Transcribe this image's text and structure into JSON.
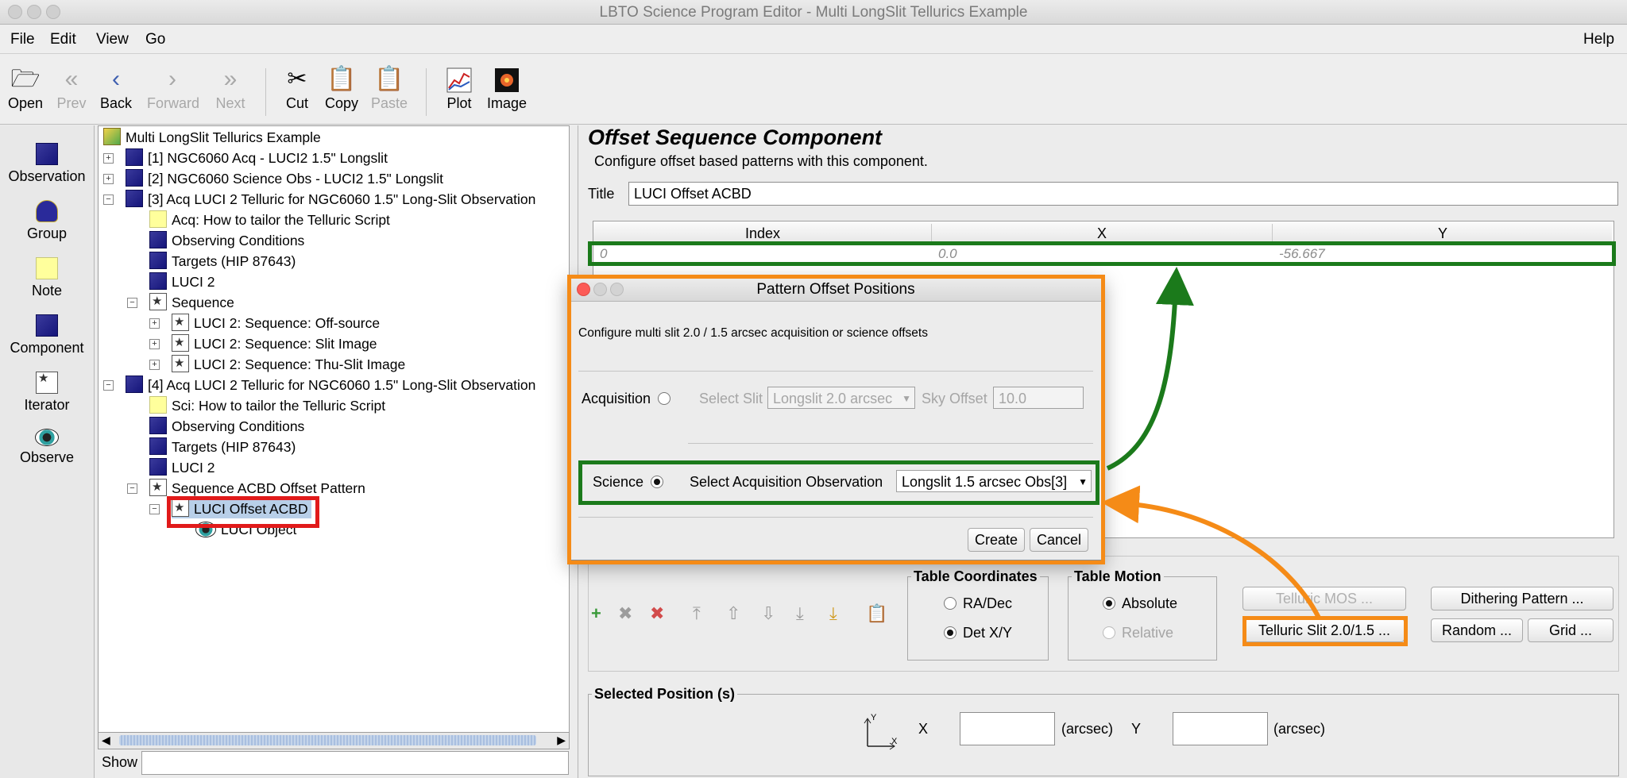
{
  "window": {
    "title": "LBTO Science Program Editor - Multi LongSlit Tellurics Example"
  },
  "menu": {
    "items": [
      "File",
      "Edit",
      "View",
      "Go"
    ],
    "help": "Help"
  },
  "toolbar": {
    "buttons": [
      {
        "label": "Open",
        "icon": "folder-icon"
      },
      {
        "label": "Prev",
        "icon": "double-left-arrow-icon"
      },
      {
        "label": "Back",
        "icon": "left-arrow-icon"
      },
      {
        "label": "Forward",
        "icon": "right-arrow-icon"
      },
      {
        "label": "Next",
        "icon": "double-right-arrow-icon"
      },
      {
        "label": "Cut",
        "icon": "scissors-icon"
      },
      {
        "label": "Copy",
        "icon": "copy-icon"
      },
      {
        "label": "Paste",
        "icon": "clipboard-icon"
      },
      {
        "label": "Plot",
        "icon": "plot-icon"
      },
      {
        "label": "Image",
        "icon": "image-icon"
      }
    ]
  },
  "palette": {
    "items": [
      "Observation",
      "Group",
      "Note",
      "Component",
      "Iterator",
      "Observe"
    ]
  },
  "tree": {
    "nodes": [
      "Multi LongSlit Tellurics Example",
      "[1] NGC6060 Acq - LUCI2 1.5\" Longslit",
      "[2] NGC6060 Science Obs - LUCI2 1.5\" Longslit",
      "[3] Acq LUCI 2 Telluric for NGC6060 1.5\" Long-Slit Observation",
      "Acq: How to tailor the Telluric Script",
      "Observing Conditions",
      "Targets (HIP 87643)",
      "LUCI 2",
      "Sequence",
      "LUCI 2: Sequence: Off-source",
      "LUCI 2: Sequence: Slit Image",
      "LUCI 2: Sequence: Thu-Slit Image",
      "[4] Acq LUCI 2 Telluric for NGC6060 1.5\" Long-Slit Observation",
      "Sci: How to tailor the Telluric Script",
      "Observing Conditions",
      "Targets (HIP 87643)",
      "LUCI 2",
      "Sequence ACBD Offset Pattern",
      "LUCI Offset ACBD",
      "LUCI Object"
    ],
    "show_label": "Show"
  },
  "component": {
    "heading": "Offset Sequence Component",
    "description": "Configure offset based patterns with this component.",
    "title_label": "Title",
    "title_value": "LUCI Offset ACBD",
    "table": {
      "columns": [
        "Index",
        "X",
        "Y"
      ],
      "rows": [
        [
          "0",
          "0.0",
          "-56.667"
        ]
      ]
    },
    "table_coordinates": {
      "legend": "Table Coordinates",
      "options": [
        "RA/Dec",
        "Det X/Y"
      ],
      "selected": "Det X/Y"
    },
    "table_motion": {
      "legend": "Table Motion",
      "options": [
        "Absolute",
        "Relative"
      ],
      "selected": "Absolute"
    },
    "buttons": {
      "telluric_mos": "Telluric MOS ...",
      "dithering": "Dithering Pattern ...",
      "telluric_slit": "Telluric Slit 2.0/1.5 ...",
      "random": "Random ...",
      "grid": "Grid ..."
    },
    "selected_position": {
      "legend": "Selected Position (s)",
      "x_label": "X",
      "y_label": "Y",
      "unit": "(arcsec)",
      "axis_y": "Y",
      "axis_x": "X"
    }
  },
  "dialog": {
    "title": "Pattern Offset Positions",
    "description": "Configure multi slit 2.0 / 1.5 arcsec acquisition or science offsets",
    "acquisition_label": "Acquisition",
    "select_slit_label": "Select Slit",
    "select_slit_value": "Longslit 2.0 arcsec",
    "sky_offset_label": "Sky Offset",
    "sky_offset_value": "10.0",
    "science_label": "Science",
    "select_acq_obs_label": "Select Acquisition Observation",
    "select_acq_obs_value": "Longslit 1.5 arcsec Obs[3]",
    "create": "Create",
    "cancel": "Cancel"
  },
  "colors": {
    "annotation_green": "#1b7a1b",
    "annotation_orange": "#f58b17",
    "annotation_red": "#e11a1a",
    "selection": "#b8cfe8"
  }
}
